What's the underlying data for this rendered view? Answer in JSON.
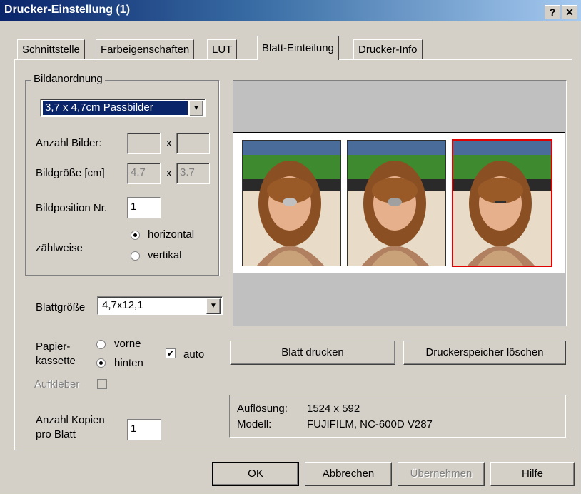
{
  "window": {
    "title": "Drucker-Einstellung (1)",
    "help_btn": "?",
    "close_btn": "✕"
  },
  "tabs": [
    "Schnittstelle",
    "Farbeigenschaften",
    "LUT",
    "Blatt-Einteilung",
    "Drucker-Info"
  ],
  "active_tab": "Blatt-Einteilung",
  "layout_group": {
    "legend": "Bildanordnung",
    "preset": "3,7 x 4,7cm Passbilder",
    "count_label": "Anzahl Bilder:",
    "count_x": "",
    "count_y": "",
    "times": "x",
    "size_label": "Bildgröße [cm]",
    "size_w": "4.7",
    "size_h": "3.7",
    "position_label": "Bildposition Nr.",
    "position_value": "1",
    "count_mode_label": "zählweise",
    "horizontal": "horizontal",
    "vertical": "vertikal",
    "count_mode_selected": "horizontal"
  },
  "sheet_size": {
    "label": "Blattgröße",
    "value": "4,7x12,1"
  },
  "paper": {
    "label_line1": "Papier-",
    "label_line2": "kassette",
    "front": "vorne",
    "back": "hinten",
    "selected": "hinten",
    "auto_label": "auto",
    "auto_checked": true,
    "sticker_label": "Aufkleber",
    "sticker_checked": false
  },
  "copies": {
    "label_line1": "Anzahl Kopien",
    "label_line2": "pro Blatt",
    "value": "1"
  },
  "actions": {
    "print_sheet": "Blatt drucken",
    "clear_memory": "Druckerspeicher löschen"
  },
  "info": {
    "resolution_label": "Auflösung:",
    "resolution_value": "1524 x 592",
    "model_label": "Modell:",
    "model_value": "FUJIFILM, NC-600D V287"
  },
  "preview": {
    "photo_count": 3,
    "selected_index": 3
  },
  "footer": {
    "ok": "OK",
    "cancel": "Abbrechen",
    "apply": "Übernehmen",
    "help": "Hilfe"
  },
  "colors": {
    "titlebar": "#0a246a",
    "selection": "#0a246a",
    "selected_photo_border": "#e00000",
    "face": "#d4d0c8"
  }
}
